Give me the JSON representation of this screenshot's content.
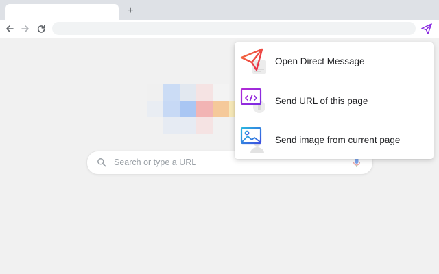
{
  "browser": {
    "new_tab_symbol": "+",
    "address_bar_value": ""
  },
  "new_tab_page": {
    "search_placeholder": "Search or type a URL"
  },
  "extension_menu": {
    "items": [
      {
        "label": "Open Direct Message",
        "icon": "paper-plane-icon"
      },
      {
        "label": "Send URL of this page",
        "icon": "code-window-icon"
      },
      {
        "label": "Send image from current page",
        "icon": "image-icon"
      }
    ]
  },
  "colors": {
    "extension_accent": "#8a2be2",
    "plane_orange": "#f4743b",
    "plane_red": "#e8244c",
    "code_purple": "#b32bd6",
    "image_blue": "#2b7fe0"
  }
}
